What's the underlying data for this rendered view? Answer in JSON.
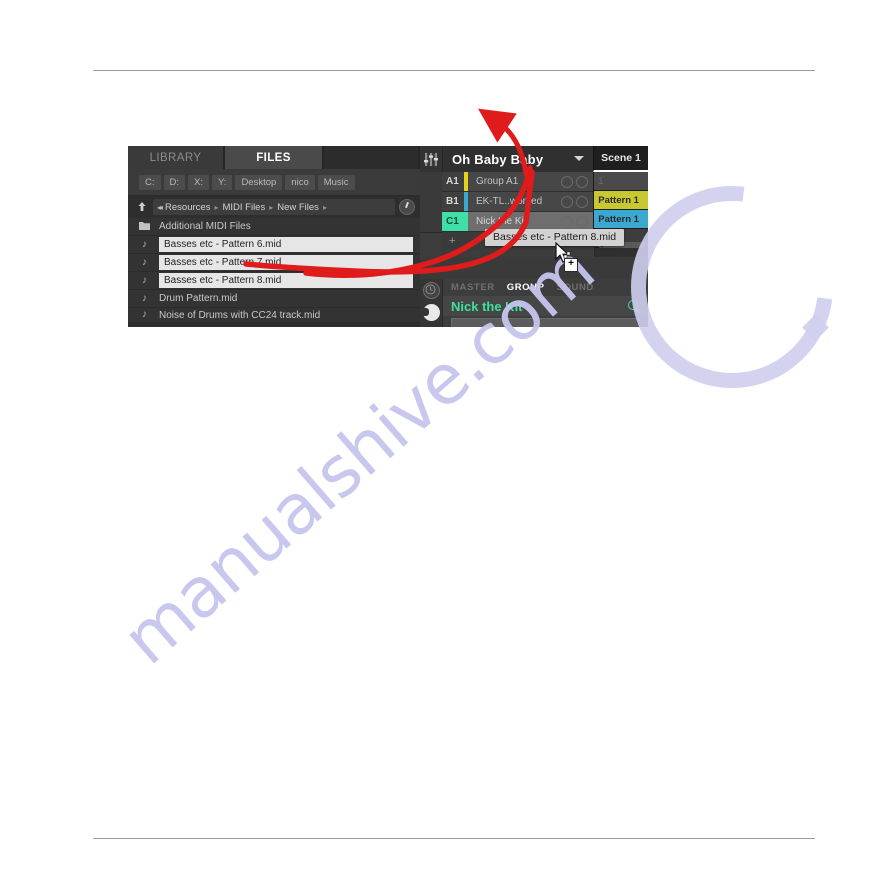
{
  "watermark": {
    "text": "manualshive.com"
  },
  "screenshot": {
    "browser": {
      "tabs": [
        {
          "label": "LIBRARY",
          "active": false
        },
        {
          "label": "FILES",
          "active": true
        }
      ],
      "shortcuts": [
        "C:",
        "D:",
        "X:",
        "Y:",
        "Desktop",
        "nico",
        "Music"
      ],
      "path": {
        "up_icon": "up-arrow-icon",
        "back_icon": "back-chevrons-icon",
        "crumbs": [
          "Resources",
          "MIDI Files",
          "New Files"
        ],
        "separator": "▸"
      },
      "files": [
        {
          "name": "Additional MIDI Files",
          "icon": "folder-icon",
          "selected": false
        },
        {
          "name": "Basses etc - Pattern 6.mid",
          "icon": "midi-note-icon",
          "selected": true
        },
        {
          "name": "Basses etc - Pattern 7.mid",
          "icon": "midi-note-icon",
          "selected": true
        },
        {
          "name": "Basses etc - Pattern 8.mid",
          "icon": "midi-note-icon",
          "selected": true
        },
        {
          "name": "Drum Pattern.mid",
          "icon": "midi-note-icon",
          "selected": false
        },
        {
          "name": "Noise of Drums with CC24 track.mid",
          "icon": "midi-note-icon",
          "selected": false
        }
      ]
    },
    "arranger": {
      "mixer_icon": "mixer-faders-icon",
      "project_name": "Oh Baby Baby",
      "project_caret_icon": "chevron-down-icon",
      "scene_header": "Scene 1",
      "groups": [
        {
          "index": "A1",
          "name": "Group A1",
          "color": "#E8D11A",
          "selected": false
        },
        {
          "index": "B1",
          "name": "EK-TL..worked",
          "color": "#3AA8D0",
          "selected": false
        },
        {
          "index": "C1",
          "name": "Nick the Kit",
          "color": "#3FE0A8",
          "selected": true
        }
      ],
      "add_group_label": "+",
      "pattern_slots": [
        {
          "label": "1",
          "color": "",
          "empty": true
        },
        {
          "label": "Pattern 1",
          "color": "#C8C832",
          "empty": false
        },
        {
          "label": "Pattern 1",
          "color": "#3AA8D0",
          "empty": false
        },
        {
          "label": "",
          "color": "",
          "empty": true
        }
      ],
      "scrollbar": "horizontal-scrollbar"
    },
    "control": {
      "tabs": [
        {
          "label": "MASTER",
          "active": false
        },
        {
          "label": "GROUP",
          "active": true
        },
        {
          "label": "SOUND",
          "active": false
        }
      ],
      "title": "Nick the Kit",
      "title_color": "#3FE09A",
      "search_icon": "magnifier-icon",
      "rail": [
        "clock-icon",
        "plug-icon"
      ]
    },
    "drag": {
      "tooltip": "Basses etc - Pattern 8.mid",
      "cursor_icon": "drag-cursor-icon",
      "badge": "+",
      "annotation_arrow": "red-curved-arrow"
    }
  }
}
